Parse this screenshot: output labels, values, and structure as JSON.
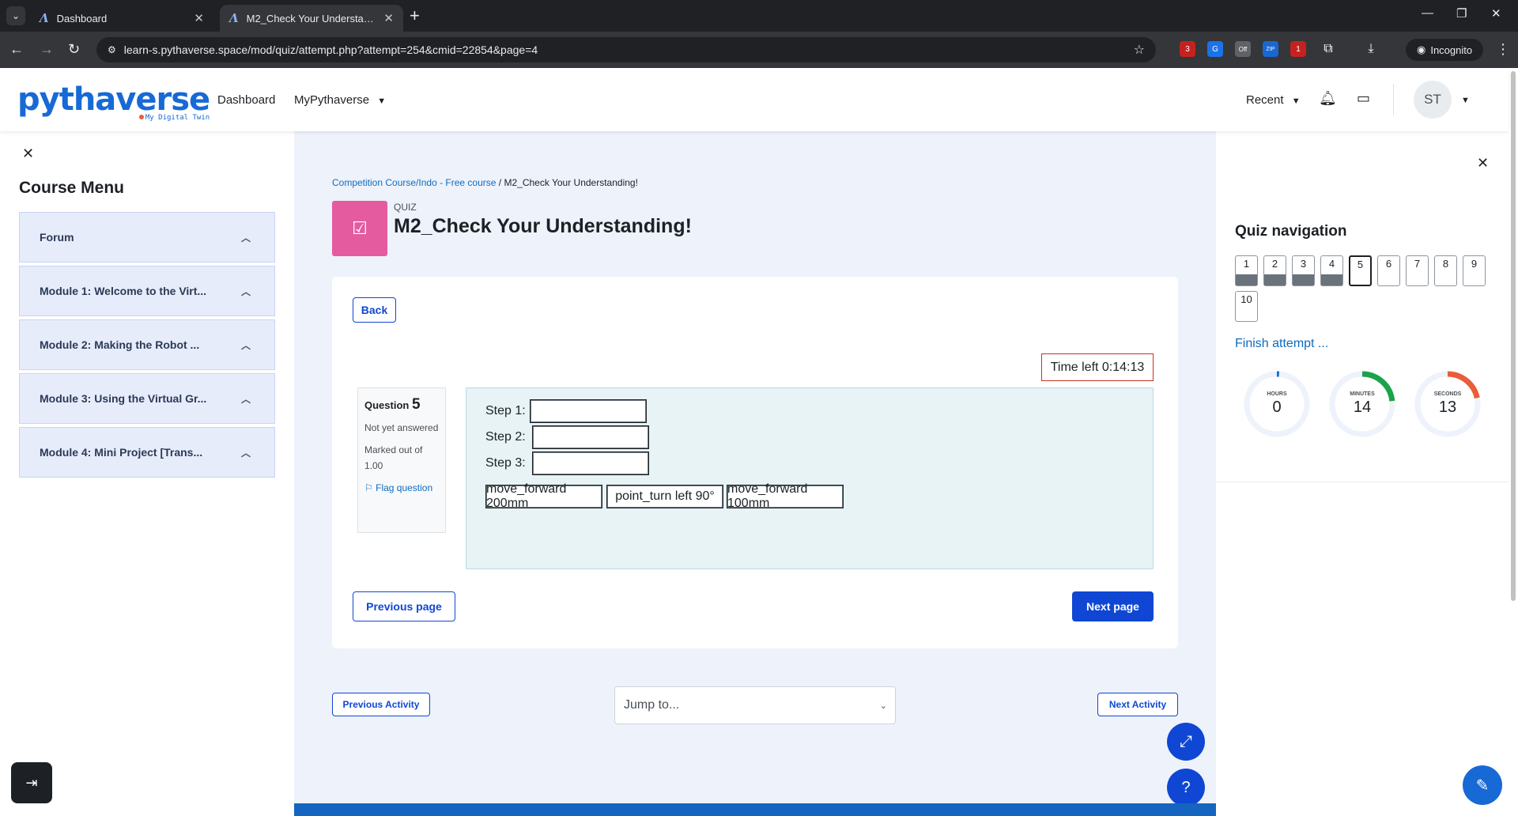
{
  "browser": {
    "tabs": [
      {
        "title": "Dashboard",
        "active": false
      },
      {
        "title": "M2_Check Your Understanding!",
        "active": true
      }
    ],
    "url": "learn-s.pythaverse.space/mod/quiz/attempt.php?attempt=254&cmid=22854&page=4",
    "incognito_label": "Incognito",
    "extension_badges": [
      "3",
      "Off",
      "1"
    ]
  },
  "header": {
    "logo_text": "pythaverse",
    "logo_tagline": "My Digital Twin",
    "nav": [
      "Dashboard",
      "MyPythaverse"
    ],
    "recent_label": "Recent",
    "avatar_initials": "ST"
  },
  "course_menu": {
    "title": "Course Menu",
    "items": [
      "Forum",
      "Module 1: Welcome to the Virt...",
      "Module 2: Making the Robot ...",
      "Module 3: Using the Virtual Gr...",
      "Module 4: Mini Project [Trans..."
    ]
  },
  "page": {
    "breadcrumb": [
      "Competition Course/Indo - Free course",
      "M2_Check Your Understanding!"
    ],
    "breadcrumb_sep": "/",
    "activity_type": "QUIZ",
    "title": "M2_Check Your Understanding!",
    "back_label": "Back",
    "time_left": "Time left 0:14:13",
    "question": {
      "label": "Question",
      "number": "5",
      "status": "Not yet answered",
      "marks": "Marked out of 1.00",
      "flag_label": "Flag question",
      "steps": [
        "Step 1:",
        "Step 2:",
        "Step 3:"
      ],
      "choices": [
        "move_forward 200mm",
        "point_turn left 90°",
        "move_forward 100mm"
      ]
    },
    "prev_page_label": "Previous page",
    "next_page_label": "Next page",
    "prev_activity_label": "Previous Activity",
    "next_activity_label": "Next Activity",
    "jump_placeholder": "Jump to..."
  },
  "quiz_navigation": {
    "title": "Quiz navigation",
    "buttons": [
      {
        "n": "1",
        "state": "answered"
      },
      {
        "n": "2",
        "state": "answered"
      },
      {
        "n": "3",
        "state": "answered"
      },
      {
        "n": "4",
        "state": "answered"
      },
      {
        "n": "5",
        "state": "current"
      },
      {
        "n": "6",
        "state": "notyet"
      },
      {
        "n": "7",
        "state": "notyet"
      },
      {
        "n": "8",
        "state": "notyet"
      },
      {
        "n": "9",
        "state": "notyet"
      },
      {
        "n": "10",
        "state": "notyet"
      }
    ],
    "finish_label": "Finish attempt ...",
    "countdown": [
      {
        "label": "HOURS",
        "value": "0",
        "fraction": 0.0,
        "color": "#1769d6"
      },
      {
        "label": "MINUTES",
        "value": "14",
        "fraction": 0.233,
        "color": "#1aa34a"
      },
      {
        "label": "SECONDS",
        "value": "13",
        "fraction": 0.217,
        "color": "#e85d3a"
      }
    ]
  },
  "colors": {
    "brand": "#1769d6",
    "primary_button": "#0f47d4",
    "quiz_icon": "#e45ba0",
    "timer_border": "#ca3120"
  }
}
